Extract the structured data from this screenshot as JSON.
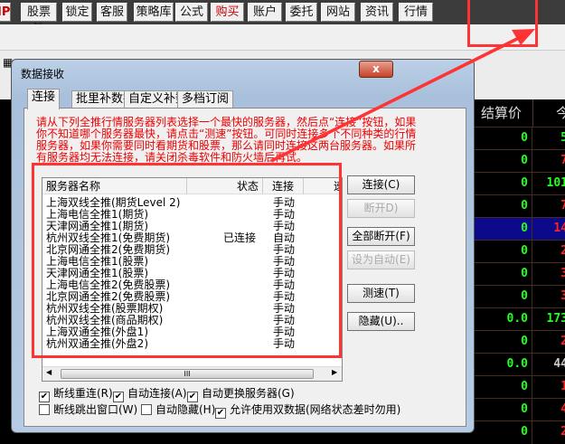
{
  "toolbar": {
    "partial": "IP",
    "buttons": [
      "股票池",
      "锁定",
      "客服",
      "策略库",
      "公式",
      "购买",
      "账户",
      "委托",
      "网站",
      "资讯",
      "行情"
    ]
  },
  "grid": {
    "headers": [
      "结算价",
      "今"
    ],
    "rows": [
      [
        "0",
        "5",
        "g"
      ],
      [
        "0",
        "7",
        "r"
      ],
      [
        "0",
        "101",
        "g"
      ],
      [
        "0",
        "7",
        "r"
      ],
      [
        "0",
        "14",
        "r"
      ],
      [
        "0",
        "2",
        "r"
      ],
      [
        "0",
        "3",
        "r"
      ],
      [
        "0",
        "3",
        "r"
      ],
      [
        "0.0",
        "173",
        "g"
      ],
      [
        "0",
        "2",
        "r"
      ],
      [
        "0.0",
        "44",
        "w"
      ],
      [
        "0",
        "1",
        "r"
      ],
      [
        "0",
        "4",
        "r"
      ],
      [
        "0",
        "2",
        "r"
      ]
    ],
    "selected_row": 4
  },
  "dialog": {
    "title": "数据接收",
    "close": "x",
    "tabs": [
      "连接",
      "批里补数据",
      "自定义补数据",
      "多档订阅"
    ],
    "message": "请从下列全推行情服务器列表选择一个最快的服务器，然后点“连接”按钮，如果你不知道哪个服务器最快，请点击“测速”按钮。可同时连接多个不同种类的行情服务器，如果你需要同时看期货和股票，那么请同时连接这两台服务器。如果所有服务器均无法连接，请关闭杀毒软件和防火墙后再试。",
    "columns": [
      "服务器名称",
      "状态",
      "连接",
      "速"
    ],
    "servers": [
      {
        "name": "上海双线全推(期货Level 2)",
        "status": "",
        "mode": "手动"
      },
      {
        "name": "上海电信全推1(期货)",
        "status": "",
        "mode": "手动"
      },
      {
        "name": "天津网通全推1(期货)",
        "status": "",
        "mode": "手动"
      },
      {
        "name": "杭州双线全推1(免费期货)",
        "status": "已连接",
        "mode": "自动"
      },
      {
        "name": "北京网通全推2(免费期货)",
        "status": "",
        "mode": "手动"
      },
      {
        "name": "上海电信全推1(股票)",
        "status": "",
        "mode": "手动"
      },
      {
        "name": "天津网通全推1(股票)",
        "status": "",
        "mode": "手动"
      },
      {
        "name": "上海电信全推2(免费股票)",
        "status": "",
        "mode": "手动"
      },
      {
        "name": "北京网通全推2(免费股票)",
        "status": "",
        "mode": "手动"
      },
      {
        "name": "杭州双线全推(股票期权)",
        "status": "",
        "mode": "手动"
      },
      {
        "name": "杭州双线全推(商品期权)",
        "status": "",
        "mode": "手动"
      },
      {
        "name": "上海双通全推(外盘1)",
        "status": "",
        "mode": "手动"
      },
      {
        "name": "杭州双通全推(外盘2)",
        "status": "",
        "mode": "手动"
      }
    ],
    "buttons": {
      "connect": "连接(C)",
      "disconnect": "断开D)",
      "disconnect_all": "全部断开(F)",
      "set_auto": "设为自动(E)",
      "speed_test": "测速(T)",
      "hide": "隐藏(U).."
    },
    "options": [
      {
        "label": "断线重连(R)",
        "checked": true
      },
      {
        "label": "自动连接(A)",
        "checked": true
      },
      {
        "label": "自动更换服务器(G)",
        "checked": true
      },
      {
        "label": "断线跳出窗口(W)",
        "checked": false
      },
      {
        "label": "自动隐藏(H)",
        "checked": false
      },
      {
        "label": "允许使用双数据(网络状态差时勿用)",
        "checked": true
      }
    ],
    "scroll_thumb": "III"
  },
  "colors": {
    "annotation": "#ff3333",
    "up": "#ff2020",
    "down": "#22ee22"
  }
}
